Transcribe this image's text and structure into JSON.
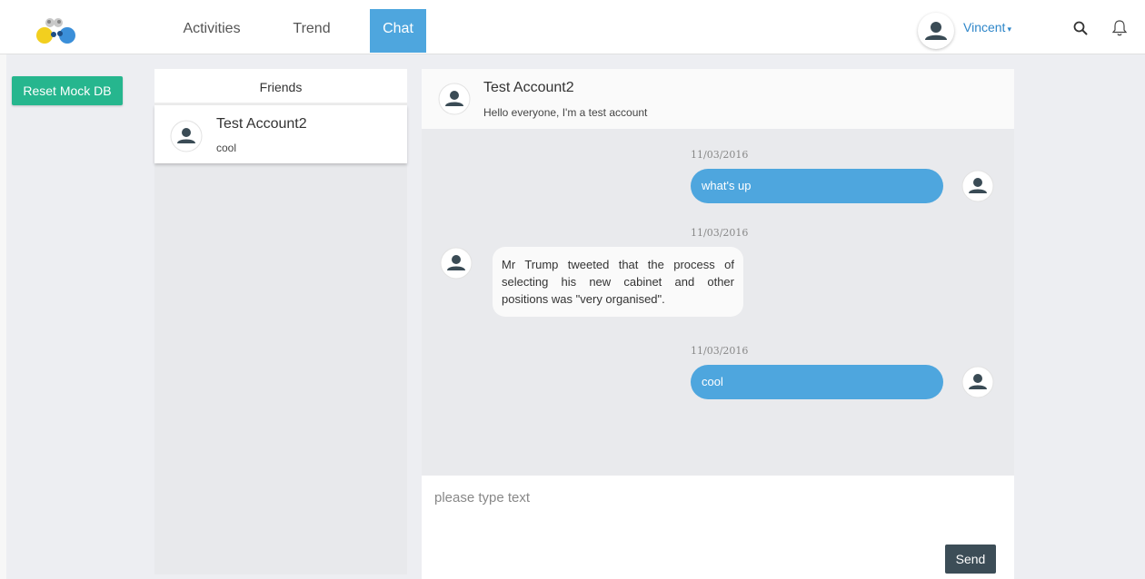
{
  "nav": {
    "tabs": [
      {
        "label": "Activities"
      },
      {
        "label": "Trend"
      },
      {
        "label": "Chat"
      }
    ],
    "user_name": "Vincent",
    "caret": "▾"
  },
  "colors": {
    "accent": "#4ea6de",
    "reset_button": "#26b68e",
    "send_button": "#3c4d57"
  },
  "icons": {
    "logo": "app-logo-icon",
    "search": "search-icon",
    "notifications": "bell-icon",
    "avatar": "user-avatar-icon"
  },
  "sidebar": {
    "reset_label": "Reset Mock DB"
  },
  "friends": {
    "title": "Friends",
    "items": [
      {
        "name": "Test Account2",
        "last_message": "cool"
      }
    ]
  },
  "chat": {
    "contact_name": "Test Account2",
    "contact_status": "Hello everyone, I'm a test account",
    "messages": [
      {
        "date": "11/03/2016",
        "text": "what's up",
        "direction": "outgoing"
      },
      {
        "date": "11/03/2016",
        "text": "Mr Trump tweeted that the process of selecting his new cabinet and other positions was \"very organised\".",
        "direction": "incoming"
      },
      {
        "date": "11/03/2016",
        "text": "cool",
        "direction": "outgoing"
      }
    ],
    "input_placeholder": "please type text",
    "send_label": "Send"
  }
}
